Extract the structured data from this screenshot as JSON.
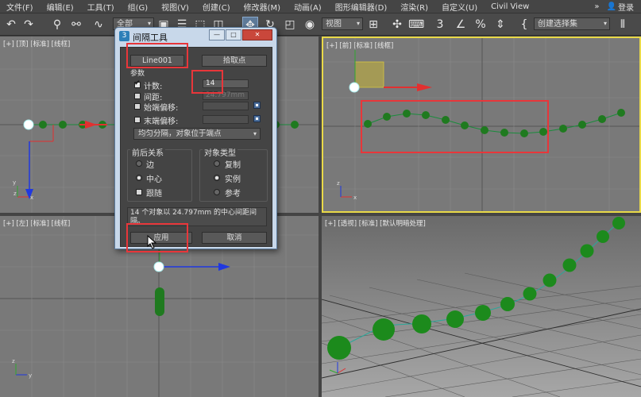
{
  "menu": {
    "items": [
      "文件(F)",
      "编辑(E)",
      "工具(T)",
      "组(G)",
      "视图(V)",
      "创建(C)",
      "修改器(M)",
      "动画(A)",
      "图形编辑器(D)",
      "渲染(R)",
      "自定义(U)",
      "Civil View"
    ],
    "more": "»",
    "login": "登录"
  },
  "toolbar": {
    "filter_select": "全部",
    "view_select": "视图",
    "selection_set": "创建选择集"
  },
  "viewports": {
    "top": "[+] [顶] [标准] [线框]",
    "front": "[+] [前] [标准] [线框]",
    "left": "[+] [左] [标准] [线框]",
    "perspective": "[+] [透视] [标准] [默认明暗处理]"
  },
  "axis": {
    "x": "x",
    "y": "y",
    "z": "z"
  },
  "dialog": {
    "title": "间隔工具",
    "icon_letter": "3",
    "min_btn": "—",
    "max_btn": "□",
    "close_btn": "✕",
    "path_button": "Line001",
    "pick_points_button": "拾取点",
    "params_label": "参数",
    "count_label": "计数:",
    "count_value": "14",
    "spacing_label": "间距:",
    "spacing_value": "24.797mm",
    "start_offset_label": "始端偏移:",
    "end_offset_label": "末端偏移:",
    "distribution_select": "均匀分隔，对象位于端点",
    "context_group": "前后关系",
    "context_edges": "边",
    "context_centers": "中心",
    "context_follow": "跟随",
    "type_group": "对象类型",
    "type_copy": "复制",
    "type_instance": "实例",
    "type_reference": "参考",
    "status_text": "14 个对象以 24.797mm 的中心间距间隔。",
    "apply_button": "应用",
    "cancel_button": "取消"
  },
  "colors": {
    "accent_red": "#e8363a",
    "object_green": "#1f8a1f",
    "viewport_gray": "#797979",
    "active_border": "#e9d948"
  }
}
